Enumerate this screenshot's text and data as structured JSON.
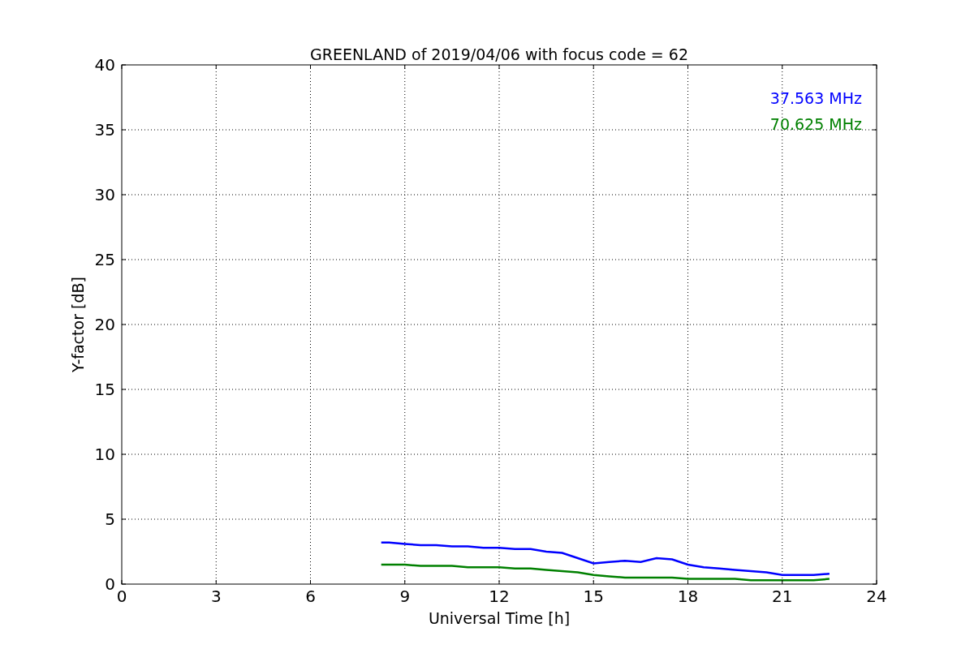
{
  "chart_data": {
    "type": "line",
    "title": "GREENLAND of 2019/04/06 with focus code = 62",
    "xlabel": "Universal Time [h]",
    "ylabel": "Y-factor [dB]",
    "x": [
      8.25,
      8.5,
      9,
      9.5,
      10,
      10.5,
      11,
      11.5,
      12,
      12.5,
      13,
      13.5,
      14,
      14.5,
      15,
      15.5,
      16,
      16.5,
      17,
      17.5,
      18,
      18.5,
      19,
      19.5,
      20,
      20.5,
      21,
      21.5,
      22,
      22.5
    ],
    "series": [
      {
        "name": "37.563 MHz",
        "color": "#0000ff",
        "values": [
          3.2,
          3.2,
          3.1,
          3.0,
          3.0,
          2.9,
          2.9,
          2.8,
          2.8,
          2.7,
          2.7,
          2.5,
          2.4,
          2.0,
          1.6,
          1.7,
          1.8,
          1.7,
          2.0,
          1.9,
          1.5,
          1.3,
          1.2,
          1.1,
          1.0,
          0.9,
          0.7,
          0.7,
          0.7,
          0.8
        ]
      },
      {
        "name": "70.625 MHz",
        "color": "#008000",
        "values": [
          1.5,
          1.5,
          1.5,
          1.4,
          1.4,
          1.4,
          1.3,
          1.3,
          1.3,
          1.2,
          1.2,
          1.1,
          1.0,
          0.9,
          0.7,
          0.6,
          0.5,
          0.5,
          0.5,
          0.5,
          0.4,
          0.4,
          0.4,
          0.4,
          0.3,
          0.3,
          0.3,
          0.3,
          0.3,
          0.4
        ]
      }
    ],
    "xlim": [
      0,
      24
    ],
    "ylim": [
      0,
      40
    ],
    "xticks": [
      0,
      3,
      6,
      9,
      12,
      15,
      18,
      21,
      24
    ],
    "yticks": [
      0,
      5,
      10,
      15,
      20,
      25,
      30,
      35,
      40
    ],
    "grid": true
  }
}
